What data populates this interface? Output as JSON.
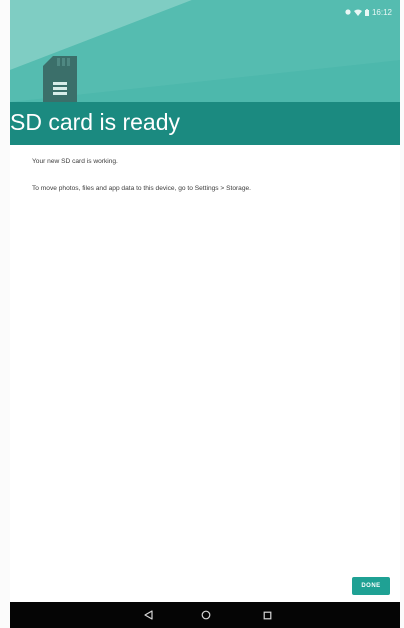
{
  "status_bar": {
    "time": "16:12",
    "icons": [
      "notification-dot-icon",
      "wifi-icon",
      "battery-icon"
    ]
  },
  "header": {
    "icon": "sd-card-icon",
    "title": "SD card is ready"
  },
  "content": {
    "line1": "Your new SD card is working.",
    "line2": "To move photos, files and app data to this device, go to Settings > Storage."
  },
  "actions": {
    "done_label": "DONE"
  },
  "nav_bar": {
    "icons": [
      "back-icon",
      "home-icon",
      "recents-icon"
    ]
  },
  "colors": {
    "header_light": "#4eb9ad",
    "header_dark": "#1b8a80",
    "accent": "#1fa194",
    "nav_bar": "#050505"
  }
}
